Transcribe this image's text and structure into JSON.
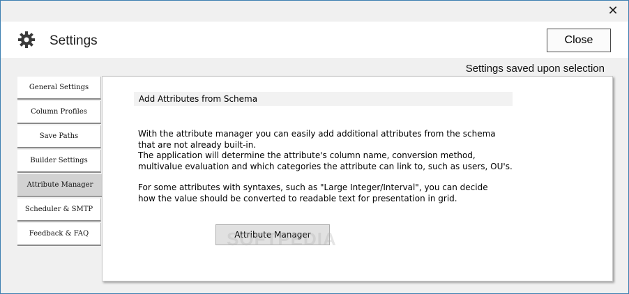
{
  "window": {
    "close_glyph": "✕",
    "title": "Settings",
    "close_button_label": "Close",
    "saved_note": "Settings saved upon selection"
  },
  "nav": {
    "active": "Attribute Manager",
    "items": [
      {
        "label": "General Settings"
      },
      {
        "label": "Column Profiles"
      },
      {
        "label": "Save Paths"
      },
      {
        "label": "Builder Settings"
      },
      {
        "label": "Attribute Manager"
      },
      {
        "label": "Scheduler & SMTP"
      },
      {
        "label": "Feedback & FAQ"
      }
    ]
  },
  "panel": {
    "section_title": "Add Attributes from Schema",
    "paragraph1": "With the attribute manager you can easily add additional attributes from the schema\nthat are not already built-in.\nThe application will determine the attribute's column name, conversion method,\nmultivalue evaluation and which categories the attribute can link to, such as users, OU's.",
    "paragraph2": "For some attributes with syntaxes, such as \"Large Integer/Interval\", you can decide\nhow the value should be converted to readable text for presentation in grid.",
    "button_label": "Attribute Manager",
    "watermark": "SOFTPEDIA"
  },
  "colors": {
    "accent_border": "#3c7fb1",
    "active_nav": "#d2d2d2",
    "background": "#f0f0f0"
  }
}
